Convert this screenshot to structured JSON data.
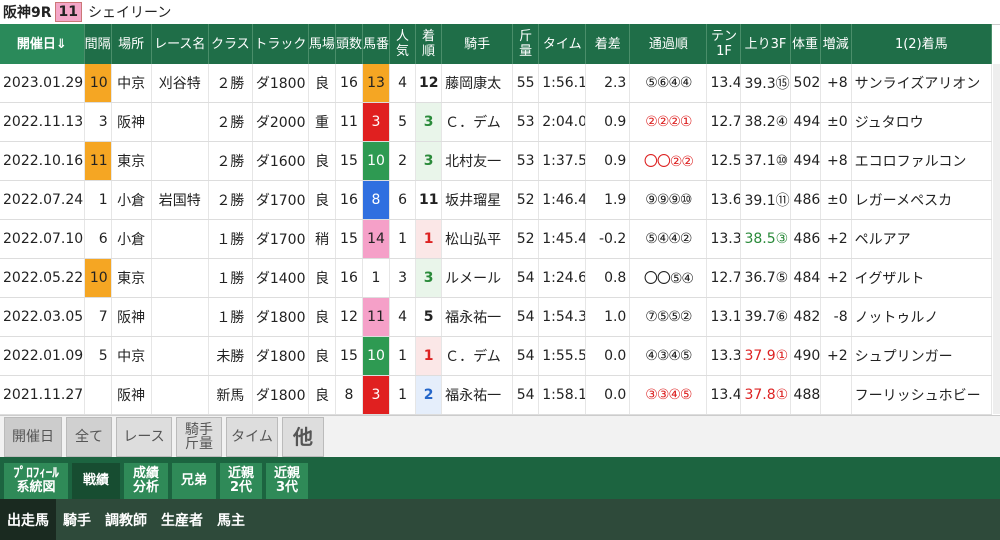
{
  "header": {
    "race": "阪神9R",
    "race_num": "11",
    "horse": "シェイリーン"
  },
  "columns": [
    "開催日⇓",
    "間隔",
    "場所",
    "レース名",
    "クラス",
    "トラック",
    "馬場",
    "頭数",
    "馬番",
    "人気",
    "着順",
    "騎手",
    "斤量",
    "タイム",
    "着差",
    "通過順",
    "テン1F",
    "上り3F",
    "体重",
    "増減",
    "1(2)着馬"
  ],
  "rows": [
    {
      "date": "2023.01.29",
      "interval": "10",
      "interval_hl": true,
      "place": "中京",
      "race": "刈谷特",
      "cls": "２勝",
      "track": "ダ1800",
      "baba": "良",
      "heads": "16",
      "umaban": "13",
      "gate_color": "#f5a623",
      "gate_text": "#222",
      "pop": "4",
      "rank": "12",
      "jockey": "藤岡康太",
      "kin": "55",
      "time": "1:56.1",
      "margin": "2.3",
      "pass": "⑤⑥④④",
      "pass_color": "#222",
      "ten": "13.4",
      "agari": "39.3⑮",
      "agari_color": "#222",
      "weight": "502",
      "diff": "+8",
      "winner": "サンライズアリオン"
    },
    {
      "date": "2022.11.13",
      "interval": "3",
      "interval_hl": false,
      "place": "阪神",
      "race": "",
      "cls": "２勝",
      "track": "ダ2000",
      "baba": "重",
      "heads": "11",
      "umaban": "3",
      "gate_color": "#e02020",
      "gate_text": "#fff",
      "pop": "5",
      "rank": "3",
      "jockey": "Ｃ．デム",
      "kin": "53",
      "time": "2:04.0",
      "margin": "0.9",
      "pass": "②②②①",
      "pass_color": "#d22",
      "ten": "12.7",
      "agari": "38.2④",
      "agari_color": "#222",
      "weight": "494",
      "diff": "±0",
      "winner": "ジュタロウ"
    },
    {
      "date": "2022.10.16",
      "interval": "11",
      "interval_hl": true,
      "place": "東京",
      "race": "",
      "cls": "２勝",
      "track": "ダ1600",
      "baba": "良",
      "heads": "15",
      "umaban": "10",
      "gate_color": "#2e9a52",
      "gate_text": "#fff",
      "pop": "2",
      "rank": "3",
      "jockey": "北村友一",
      "kin": "53",
      "time": "1:37.5",
      "margin": "0.9",
      "pass": "〇〇②②",
      "pass_color": "#d22",
      "ten": "12.5",
      "agari": "37.1⑩",
      "agari_color": "#222",
      "weight": "494",
      "diff": "+8",
      "winner": "エコロファルコン"
    },
    {
      "date": "2022.07.24",
      "interval": "1",
      "interval_hl": false,
      "place": "小倉",
      "race": "岩国特",
      "cls": "２勝",
      "track": "ダ1700",
      "baba": "良",
      "heads": "16",
      "umaban": "8",
      "gate_color": "#2f6fe0",
      "gate_text": "#fff",
      "pop": "6",
      "rank": "11",
      "jockey": "坂井瑠星",
      "kin": "52",
      "time": "1:46.4",
      "margin": "1.9",
      "pass": "⑨⑨⑨⑩",
      "pass_color": "#222",
      "ten": "13.6",
      "agari": "39.1⑪",
      "agari_color": "#222",
      "weight": "486",
      "diff": "±0",
      "winner": "レガーメペスカ"
    },
    {
      "date": "2022.07.10",
      "interval": "6",
      "interval_hl": false,
      "place": "小倉",
      "race": "",
      "cls": "１勝",
      "track": "ダ1700",
      "baba": "稍",
      "heads": "15",
      "umaban": "14",
      "gate_color": "#f5a0c8",
      "gate_text": "#222",
      "pop": "1",
      "rank": "1",
      "jockey": "松山弘平",
      "kin": "52",
      "time": "1:45.4",
      "margin": "-0.2",
      "pass": "⑤④④②",
      "pass_color": "#222",
      "ten": "13.3",
      "agari": "38.5③",
      "agari_color": "#2a8a3a",
      "weight": "486",
      "diff": "+2",
      "winner": "ペルアア"
    },
    {
      "date": "2022.05.22",
      "interval": "10",
      "interval_hl": true,
      "place": "東京",
      "race": "",
      "cls": "１勝",
      "track": "ダ1400",
      "baba": "良",
      "heads": "16",
      "umaban": "1",
      "gate_color": "#ffffff",
      "gate_text": "#222",
      "pop": "3",
      "rank": "3",
      "jockey": "ルメール",
      "kin": "54",
      "time": "1:24.6",
      "margin": "0.8",
      "pass": "〇〇⑤④",
      "pass_color": "#222",
      "ten": "12.7",
      "agari": "36.7⑤",
      "agari_color": "#222",
      "weight": "484",
      "diff": "+2",
      "winner": "イグザルト"
    },
    {
      "date": "2022.03.05",
      "interval": "7",
      "interval_hl": false,
      "place": "阪神",
      "race": "",
      "cls": "１勝",
      "track": "ダ1800",
      "baba": "良",
      "heads": "12",
      "umaban": "11",
      "gate_color": "#f5a0c8",
      "gate_text": "#222",
      "pop": "4",
      "rank": "5",
      "jockey": "福永祐一",
      "kin": "54",
      "time": "1:54.3",
      "margin": "1.0",
      "pass": "⑦⑤⑤②",
      "pass_color": "#222",
      "ten": "13.1",
      "agari": "39.7⑥",
      "agari_color": "#222",
      "weight": "482",
      "diff": "-8",
      "winner": "ノットゥルノ"
    },
    {
      "date": "2022.01.09",
      "interval": "5",
      "interval_hl": false,
      "place": "中京",
      "race": "",
      "cls": "未勝",
      "track": "ダ1800",
      "baba": "良",
      "heads": "15",
      "umaban": "10",
      "gate_color": "#2e9a52",
      "gate_text": "#fff",
      "pop": "1",
      "rank": "1",
      "jockey": "Ｃ．デム",
      "kin": "54",
      "time": "1:55.5",
      "margin": "0.0",
      "pass": "④③④⑤",
      "pass_color": "#222",
      "ten": "13.3",
      "agari": "37.9①",
      "agari_color": "#d22",
      "weight": "490",
      "diff": "+2",
      "winner": "シュプリンガー"
    },
    {
      "date": "2021.11.27",
      "interval": "",
      "interval_hl": false,
      "place": "阪神",
      "race": "",
      "cls": "新馬",
      "track": "ダ1800",
      "baba": "良",
      "heads": "8",
      "umaban": "3",
      "gate_color": "#e02020",
      "gate_text": "#fff",
      "pop": "1",
      "rank": "2",
      "jockey": "福永祐一",
      "kin": "54",
      "time": "1:58.1",
      "margin": "0.0",
      "pass": "③③④⑤",
      "pass_color": "#d22",
      "ten": "13.4",
      "agari": "37.8①",
      "agari_color": "#d22",
      "weight": "488",
      "diff": "",
      "winner": "フーリッシュホビー"
    }
  ],
  "sort": {
    "label": "開催日",
    "all": "全て",
    "race": "レース",
    "jockey": "騎手\n斤量",
    "time": "タイム",
    "other": "他"
  },
  "tabs1": [
    {
      "label": "ﾌﾟﾛﾌｨｰﾙ\n系統図",
      "active": false
    },
    {
      "label": "戦績",
      "active": true
    },
    {
      "label": "成績\n分析",
      "active": false
    },
    {
      "label": "兄弟",
      "active": false
    },
    {
      "label": "近親\n2代",
      "active": false
    },
    {
      "label": "近親\n3代",
      "active": false
    }
  ],
  "tabs2": [
    {
      "label": "出走馬",
      "active": true
    },
    {
      "label": "騎手",
      "active": false
    },
    {
      "label": "調教師",
      "active": false
    },
    {
      "label": "生産者",
      "active": false
    },
    {
      "label": "馬主",
      "active": false
    }
  ]
}
